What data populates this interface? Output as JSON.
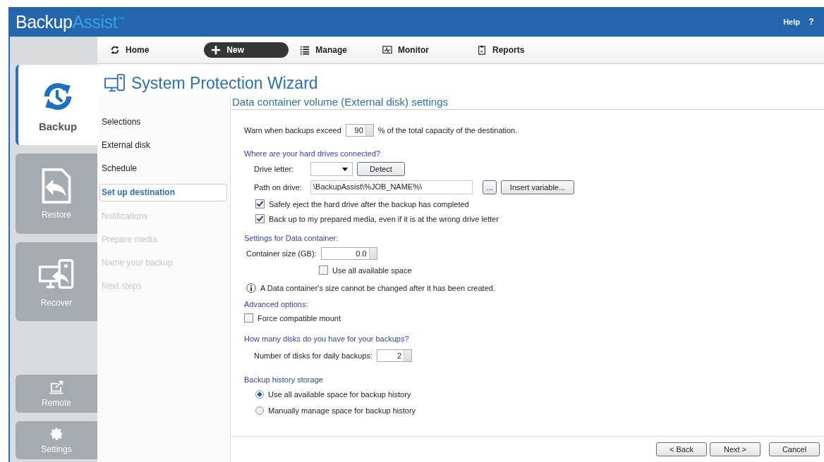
{
  "header": {
    "logo_primary": "Backup",
    "logo_secondary": "Assist",
    "logo_mark": "™",
    "help": "Help",
    "help_icon": "?"
  },
  "rail": [
    {
      "label": "Backup",
      "selected": true
    },
    {
      "label": "Restore",
      "selected": false
    },
    {
      "label": "Recover",
      "selected": false
    },
    {
      "label": "Remote",
      "selected": false
    },
    {
      "label": "Settings",
      "selected": false
    }
  ],
  "nav": [
    {
      "label": "Home",
      "selected": false
    },
    {
      "label": "New",
      "selected": true
    },
    {
      "label": "Manage",
      "selected": false
    },
    {
      "label": "Monitor",
      "selected": false
    },
    {
      "label": "Reports",
      "selected": false
    }
  ],
  "wizard_title": "System Protection Wizard",
  "steps": [
    {
      "label": "Selections",
      "selected": false,
      "disabled": false
    },
    {
      "label": "External disk",
      "selected": false,
      "disabled": false
    },
    {
      "label": "Schedule",
      "selected": false,
      "disabled": false
    },
    {
      "label": "Set up destination",
      "selected": true,
      "disabled": false
    },
    {
      "label": "Notifications",
      "selected": false,
      "disabled": true
    },
    {
      "label": "Prepare media",
      "selected": false,
      "disabled": true
    },
    {
      "label": "Name your backup",
      "selected": false,
      "disabled": true
    },
    {
      "label": "Next steps",
      "selected": false,
      "disabled": true
    }
  ],
  "section_title": "Data container volume (External disk) settings",
  "warn": {
    "label": "Warn when backups exceed",
    "value": "90",
    "suffix": "% of the total capacity of the destination."
  },
  "drives": {
    "heading": "Where are your hard drives connected?",
    "drive_letter_label": "Drive letter:",
    "detect": "Detect",
    "path_label": "Path on drive:",
    "path_value": "\\BackupAssist\\%JOB_NAME%\\",
    "browse": "...",
    "insert": "Insert variable...",
    "options": [
      {
        "label": "Safely eject the hard drive after the backup has completed",
        "checked": true
      },
      {
        "label": "Back up to my prepared media, even if it is at the wrong drive letter",
        "checked": true
      }
    ]
  },
  "container": {
    "heading": "Settings for Data container:",
    "size_label": "Container size (GB):",
    "size_value": "0.0",
    "use_all": {
      "label": "Use all available space",
      "checked": false
    },
    "note": "A Data container's size cannot be changed after it has been created."
  },
  "advanced": {
    "heading": "Advanced options:",
    "force": {
      "label": "Force compatible mount",
      "checked": false
    }
  },
  "disks": {
    "heading": "How many disks do you have for your backups?",
    "label": "Number of disks for daily backups:",
    "value": "2"
  },
  "history": {
    "heading": "Backup history storage",
    "options": [
      {
        "label": "Use all available space for backup history",
        "selected": true
      },
      {
        "label": "Manually manage space for backup history",
        "selected": false
      }
    ]
  },
  "footer": [
    "< Back",
    "Next >",
    "Cancel"
  ]
}
